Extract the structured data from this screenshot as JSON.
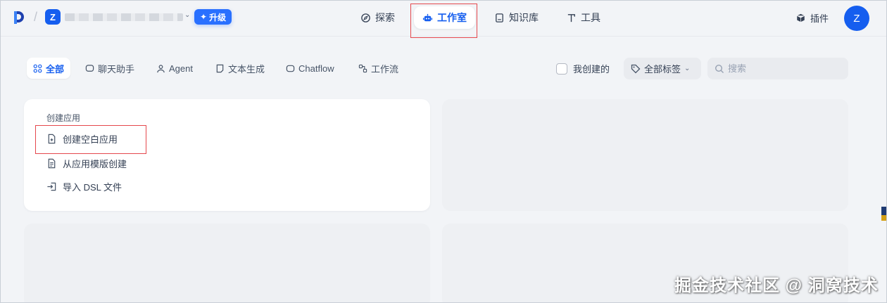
{
  "header": {
    "workspace_initial": "Z",
    "upgrade_label": "升级",
    "nav": [
      {
        "label": "探索",
        "icon": "compass-icon"
      },
      {
        "label": "工作室",
        "icon": "robot-icon",
        "active": true
      },
      {
        "label": "知识库",
        "icon": "book-icon"
      },
      {
        "label": "工具",
        "icon": "hammer-icon"
      }
    ],
    "plugin_label": "插件",
    "user_initial": "Z"
  },
  "filters": {
    "tabs": [
      {
        "label": "全部",
        "icon": "grid-icon",
        "active": true
      },
      {
        "label": "聊天助手",
        "icon": "chat-icon"
      },
      {
        "label": "Agent",
        "icon": "agent-icon"
      },
      {
        "label": "文本生成",
        "icon": "document-icon"
      },
      {
        "label": "Chatflow",
        "icon": "chatflow-icon"
      },
      {
        "label": "工作流",
        "icon": "workflow-icon"
      }
    ],
    "created_by_me_label": "我创建的",
    "tag_select_label": "全部标签",
    "search_placeholder": "搜索"
  },
  "create_card": {
    "title": "创建应用",
    "items": [
      {
        "label": "创建空白应用",
        "icon": "file-plus-icon"
      },
      {
        "label": "从应用模版创建",
        "icon": "template-icon"
      },
      {
        "label": "导入 DSL 文件",
        "icon": "import-icon"
      }
    ]
  },
  "watermark": "掘金技术社区 @ 洞窝技术",
  "colors": {
    "accent": "#155eef",
    "highlight": "#e5484d",
    "background": "#f2f4f7"
  }
}
